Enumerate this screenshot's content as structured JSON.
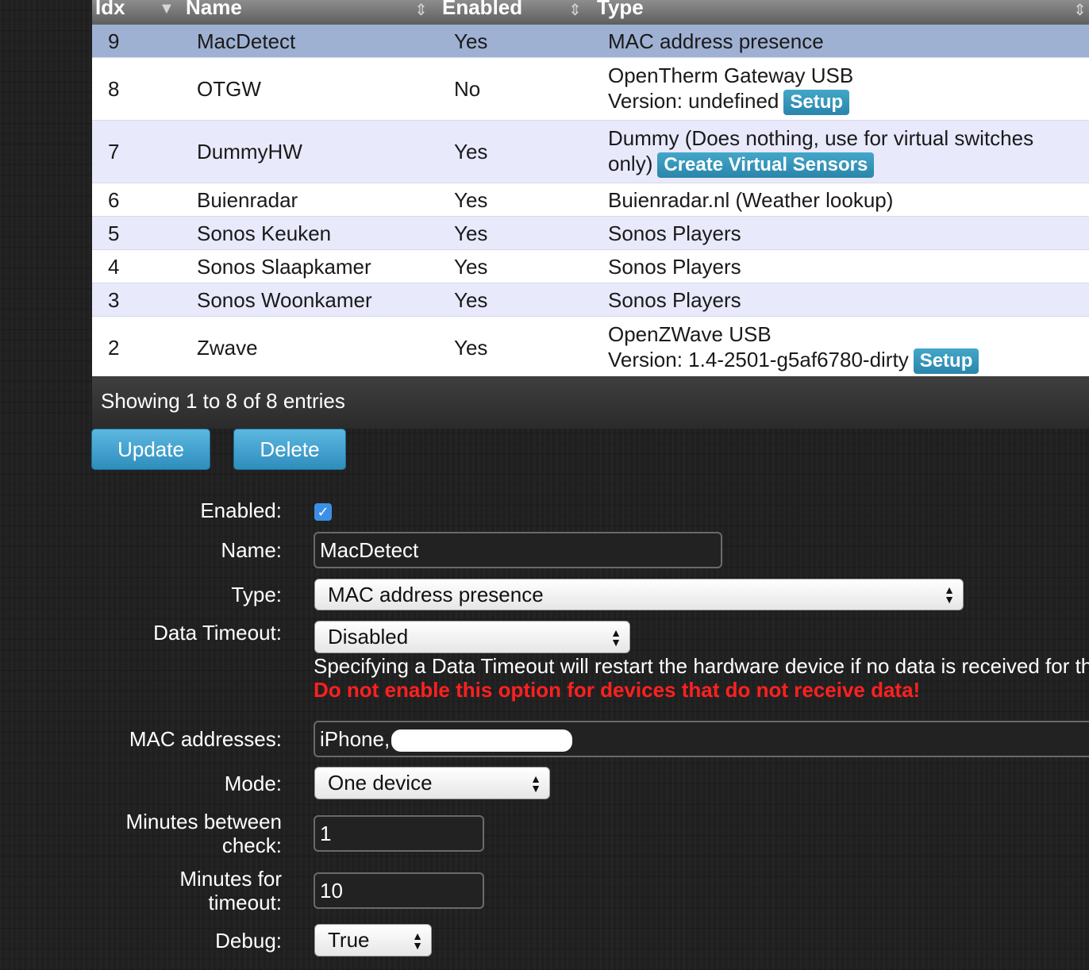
{
  "table": {
    "headers": {
      "idx": "Idx",
      "name": "Name",
      "enabled": "Enabled",
      "type": "Type"
    },
    "rows": [
      {
        "idx": "9",
        "name": "MacDetect",
        "enabled": "Yes",
        "type": "MAC address presence",
        "type_extra": "",
        "button": ""
      },
      {
        "idx": "8",
        "name": "OTGW",
        "enabled": "No",
        "type": "OpenTherm Gateway USB",
        "type_extra": "Version: undefined",
        "button": "Setup"
      },
      {
        "idx": "7",
        "name": "DummyHW",
        "enabled": "Yes",
        "type": "Dummy (Does nothing, use for virtual switches",
        "type_extra": "only)",
        "button": "Create Virtual Sensors"
      },
      {
        "idx": "6",
        "name": "Buienradar",
        "enabled": "Yes",
        "type": "Buienradar.nl (Weather lookup)",
        "type_extra": "",
        "button": ""
      },
      {
        "idx": "5",
        "name": "Sonos Keuken",
        "enabled": "Yes",
        "type": "Sonos Players",
        "type_extra": "",
        "button": ""
      },
      {
        "idx": "4",
        "name": "Sonos Slaapkamer",
        "enabled": "Yes",
        "type": "Sonos Players",
        "type_extra": "",
        "button": ""
      },
      {
        "idx": "3",
        "name": "Sonos Woonkamer",
        "enabled": "Yes",
        "type": "Sonos Players",
        "type_extra": "",
        "button": ""
      },
      {
        "idx": "2",
        "name": "Zwave",
        "enabled": "Yes",
        "type": "OpenZWave USB",
        "type_extra": "Version: 1.4-2501-g5af6780-dirty",
        "button": "Setup"
      }
    ],
    "footer": "Showing 1 to 8 of 8 entries"
  },
  "actions": {
    "update": "Update",
    "delete": "Delete"
  },
  "form": {
    "enabled_label": "Enabled:",
    "enabled_checked": true,
    "name_label": "Name:",
    "name_value": "MacDetect",
    "type_label": "Type:",
    "type_value": "MAC address presence",
    "timeout_label": "Data Timeout:",
    "timeout_value": "Disabled",
    "timeout_help": "Specifying a Data Timeout will restart the hardware device if no data is received for th",
    "timeout_warning": "Do not enable this option for devices that do not receive data!",
    "mac_label": "MAC addresses:",
    "mac_value": "iPhone,",
    "mode_label": "Mode:",
    "mode_value": "One device",
    "minutes_check_label": "Minutes between check:",
    "minutes_check_value": "1",
    "minutes_timeout_label": "Minutes for timeout:",
    "minutes_timeout_value": "10",
    "debug_label": "Debug:",
    "debug_value": "True"
  },
  "colors": {
    "selected_row": "#9fb1d3",
    "odd_row": "#e8e9fb",
    "even_row": "#ffffff",
    "button_blue": "#2f8dbd",
    "warning_red": "#ff2020",
    "checkbox_blue": "#3d8fe6"
  }
}
